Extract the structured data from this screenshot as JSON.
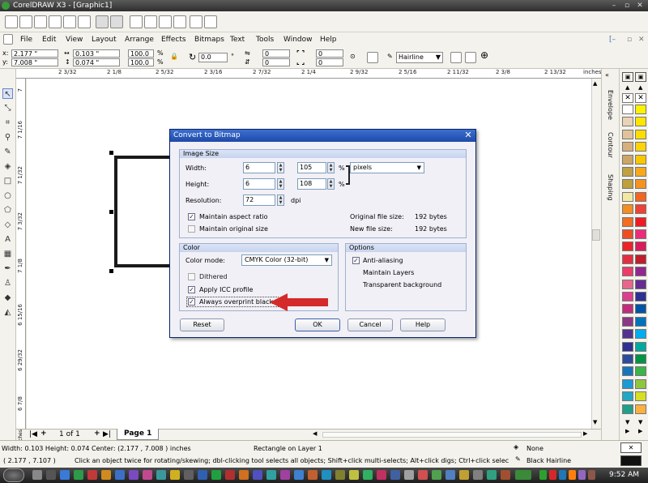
{
  "window": {
    "title": "CorelDRAW X3 - [Graphic1]"
  },
  "menu": [
    "File",
    "Edit",
    "View",
    "Layout",
    "Arrange",
    "Effects",
    "Bitmaps",
    "Text",
    "Tools",
    "Window",
    "Help"
  ],
  "property_bar": {
    "x": "2.177 \"",
    "y": "7.008 \"",
    "w": "0.103 \"",
    "h": "0.074 \"",
    "scale_x": "100.0",
    "scale_y": "100.0",
    "pct": "%",
    "rotation": "0.0",
    "deg": "°",
    "corner1": "0",
    "corner2": "0",
    "corner3": "0",
    "corner4": "0",
    "outline": "Hairline"
  },
  "ruler": {
    "unit": "inches",
    "h_ticks": [
      "2 3/32",
      "2 1/8",
      "2 5/32",
      "2 3/16",
      "2 7/32",
      "2 1/4",
      "2 9/32",
      "2 5/16",
      "2 11/32",
      "2 3/8",
      "2 13/32"
    ],
    "v_ticks": [
      "7",
      "7 1/16",
      "7 1/32",
      "7 3/32",
      "7 1/8",
      "6 15/16",
      "6 29/32",
      "6 7/8"
    ]
  },
  "dockers": [
    "Envelope",
    "Contour",
    "Shaping"
  ],
  "palette": {
    "col1": [
      "#ffffff",
      "#e9d2b5",
      "#e1c39a",
      "#d6b07c",
      "#cda566",
      "#c0a042",
      "#bea13c",
      "#f3e8a3",
      "#f48c1f",
      "#f26c22",
      "#ef4e23",
      "#ec2426",
      "#e52d42",
      "#eb3c6a",
      "#e8668e",
      "#dc3f8c",
      "#c22b7b",
      "#8c3686",
      "#54338d",
      "#2e3192",
      "#2b4c9c",
      "#1774ba",
      "#1b9ad6",
      "#24a7c4",
      "#1fa08a"
    ],
    "col2": [
      "#fff200",
      "#ffe600",
      "#ffdd00",
      "#fdd30a",
      "#f9c700",
      "#f7a81b",
      "#f6921e",
      "#f26522",
      "#ef4136",
      "#ed1c24",
      "#ee2a7b",
      "#d91c5c",
      "#be1e2d",
      "#92278f",
      "#662d91",
      "#2e3192",
      "#0054a6",
      "#0072bc",
      "#00aeef",
      "#00a99d",
      "#009444",
      "#39b54a",
      "#8dc63f",
      "#d7df23",
      "#fbb040"
    ]
  },
  "page_nav": {
    "counter": "1 of 1",
    "tab": "Page 1"
  },
  "status": {
    "dimensions": "Width: 0.103  Height: 0.074  Center: (2.177 , 7.008 )  inches",
    "object": "Rectangle on Layer 1",
    "fill": "None",
    "coords": "( 2.177 , 7.107 )",
    "hint": "Click an object twice for rotating/skewing; dbl-clicking tool selects all objects; Shift+click multi-selects; Alt+click digs; Ctrl+click selects in a group",
    "outline": "Black  Hairline"
  },
  "taskbar": {
    "clock": "9:52 AM"
  },
  "dialog": {
    "title": "Convert to Bitmap",
    "image_size": {
      "title": "Image Size",
      "width_label": "Width:",
      "width_value": "6",
      "width_pct": "105",
      "height_label": "Height:",
      "height_value": "6",
      "height_pct": "108",
      "pct_symbol": "%",
      "units": "pixels",
      "resolution_label": "Resolution:",
      "resolution_value": "72",
      "dpi": "dpi",
      "maintain_aspect": "Maintain aspect ratio",
      "maintain_original": "Maintain original size",
      "orig_size_label": "Original file size:",
      "orig_size_value": "192 bytes",
      "new_size_label": "New file size:",
      "new_size_value": "192 bytes"
    },
    "color": {
      "title": "Color",
      "mode_label": "Color mode:",
      "mode_value": "CMYK Color (32-bit)",
      "dithered": "Dithered",
      "apply_icc": "Apply ICC profile",
      "overprint": "Always overprint black"
    },
    "options": {
      "title": "Options",
      "antialias": "Anti-aliasing",
      "maintain_layers": "Maintain Layers",
      "transparent": "Transparent background"
    },
    "buttons": {
      "reset": "Reset",
      "ok": "OK",
      "cancel": "Cancel",
      "help": "Help"
    }
  }
}
